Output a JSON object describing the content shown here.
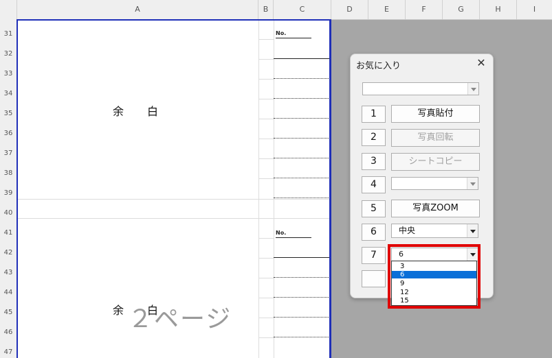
{
  "columns": [
    "A",
    "B",
    "C",
    "D",
    "E",
    "F",
    "G",
    "H",
    "I"
  ],
  "rows": [
    "31",
    "32",
    "33",
    "34",
    "35",
    "36",
    "37",
    "38",
    "39",
    "40",
    "41",
    "42",
    "43",
    "44",
    "45",
    "46",
    "47"
  ],
  "sheet": {
    "margin_text": "余白",
    "no_label": "No.",
    "watermark": "２ページ"
  },
  "dialog": {
    "title": "お気に入り",
    "close_glyph": "✕",
    "top_combo_value": "",
    "buttons": [
      {
        "num": "1",
        "label": "写真貼付",
        "enabled": true
      },
      {
        "num": "2",
        "label": "写真回転",
        "enabled": false
      },
      {
        "num": "3",
        "label": "シートコピー",
        "enabled": false
      },
      {
        "num": "4",
        "label": "",
        "enabled": false
      },
      {
        "num": "5",
        "label": "写真ZOOM",
        "enabled": true
      },
      {
        "num": "6",
        "label": "中央",
        "enabled": true
      },
      {
        "num": "7",
        "label": "6",
        "enabled": true
      }
    ],
    "dropdown_options": [
      "3",
      "6",
      "9",
      "12",
      "15"
    ],
    "dropdown_selected": "6"
  },
  "colors": {
    "print_border": "#1f2fb8",
    "highlight": "#e00000",
    "selection": "#0a6fd8"
  }
}
